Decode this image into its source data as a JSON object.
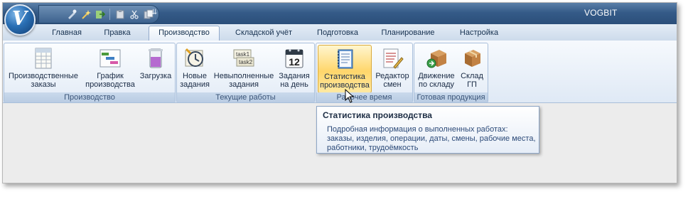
{
  "app": {
    "title": "VOGBIT",
    "logo_letter": "V"
  },
  "quick_access": {
    "icons": [
      "tools-icon",
      "wizard-icon",
      "exit-icon",
      "clipboard-icon",
      "scissors-icon",
      "paste-icon"
    ],
    "more": "⇊"
  },
  "tabs": [
    {
      "label": "Главная",
      "active": false
    },
    {
      "label": "Правка",
      "active": false
    },
    {
      "label": "Производство",
      "active": true
    },
    {
      "label": "Складской учёт",
      "active": false
    },
    {
      "label": "Подготовка",
      "active": false
    },
    {
      "label": "Планирование",
      "active": false
    },
    {
      "label": "Настройка",
      "active": false
    }
  ],
  "groups": [
    {
      "label": "Производство",
      "buttons": [
        {
          "line1": "Производственные",
          "line2": "заказы",
          "icon": "orders-table-icon"
        },
        {
          "line1": "График",
          "line2": "производства",
          "icon": "gantt-chart-icon"
        },
        {
          "line1": "Загрузка",
          "line2": "",
          "icon": "beaker-load-icon"
        }
      ]
    },
    {
      "label": "Текущие работы",
      "buttons": [
        {
          "line1": "Новые",
          "line2": "задания",
          "icon": "new-task-icon"
        },
        {
          "line1": "Невыполненные",
          "line2": "задания",
          "icon": "pending-tasks-icon",
          "badge1": "task1",
          "badge2": "task2"
        },
        {
          "line1": "Задания",
          "line2": "на день",
          "icon": "calendar-icon",
          "day": "12"
        }
      ]
    },
    {
      "label": "Рабочее время",
      "buttons": [
        {
          "line1": "Статистика",
          "line2": "производства",
          "icon": "statistics-book-icon"
        },
        {
          "line1": "Редактор",
          "line2": "смен",
          "icon": "shift-editor-icon"
        }
      ]
    },
    {
      "label": "Готовая продукция",
      "buttons": [
        {
          "line1": "Движение",
          "line2": "по складу",
          "icon": "stock-movement-icon"
        },
        {
          "line1": "Склад",
          "line2": "ГП",
          "icon": "warehouse-box-icon"
        }
      ]
    }
  ],
  "tooltip": {
    "title": "Статистика производства",
    "description": "Подробная информация о выполненных работах: заказы, изделия, операции, даты, смены, рабочие места, работники, трудоёмкость"
  },
  "colors": {
    "titlebar": "#2b4e7a",
    "hover": "#ffd66b",
    "accent": "#3a5478"
  }
}
